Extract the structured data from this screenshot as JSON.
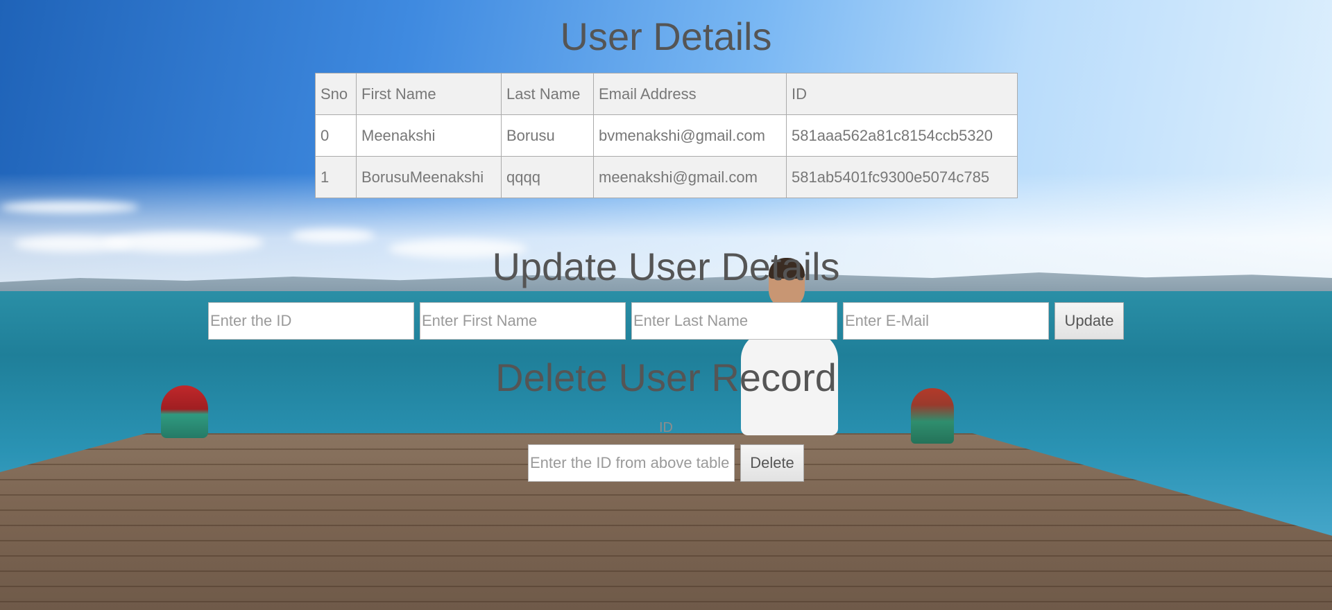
{
  "page": {
    "title": "User Details",
    "update_title": "Update User Details",
    "delete_title": "Delete User Record"
  },
  "table": {
    "headers": [
      "Sno",
      "First Name",
      "Last Name",
      "Email Address",
      "ID"
    ],
    "rows": [
      {
        "sno": "0",
        "first_name": "Meenakshi",
        "last_name": "Borusu",
        "email": "bvmenakshi@gmail.com",
        "id": "581aaa562a81c8154ccb5320"
      },
      {
        "sno": "1",
        "first_name": "BorusuMeenakshi",
        "last_name": "qqqq",
        "email": "meenakshi@gmail.com",
        "id": "581ab5401fc9300e5074c785"
      }
    ]
  },
  "update_form": {
    "id_placeholder": "Enter the ID",
    "id_value": "",
    "first_name_placeholder": "Enter First Name",
    "first_name_value": "",
    "last_name_placeholder": "Enter Last Name",
    "last_name_value": "",
    "email_placeholder": "Enter E-Mail",
    "email_value": "",
    "submit_label": "Update"
  },
  "delete_form": {
    "id_label": "ID",
    "id_placeholder": "Enter the ID from above table",
    "id_value": "",
    "submit_label": "Delete"
  }
}
